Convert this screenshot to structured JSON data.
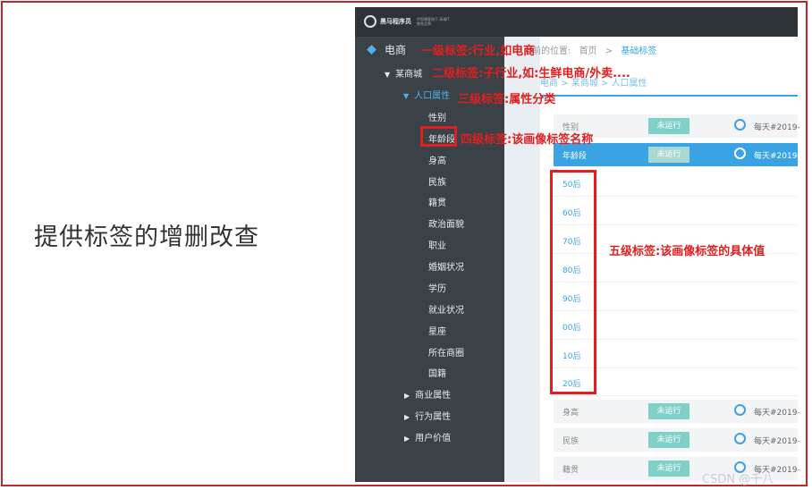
{
  "caption": "提供标签的增删改查",
  "header": {
    "logo_text": "黑马程序员",
    "logo_sub": "传智播客旗下 高端IT教育品牌"
  },
  "sidebar": {
    "level1": "电商",
    "level2": "某商城",
    "level3": "人口属性",
    "items": [
      "性别",
      "年龄段",
      "身高",
      "民族",
      "籍贯",
      "政治面貌",
      "职业",
      "婚姻状况",
      "学历",
      "就业状况",
      "星座",
      "所在商圈",
      "国籍"
    ],
    "collapsed": [
      "商业属性",
      "行为属性",
      "用户价值"
    ]
  },
  "breadcrumb": {
    "prefix": "当前的位置:",
    "home": "首页",
    "sep": ">",
    "current": "基础标签"
  },
  "path": "电商 > 某商城 > 人口属性",
  "rows_top": [
    {
      "name": "性别",
      "status": "未运行",
      "schedule": "每天#2019-"
    },
    {
      "name": "年龄段",
      "status": "未运行",
      "schedule": "每天#2019-"
    }
  ],
  "values": [
    "50后",
    "60后",
    "70后",
    "80后",
    "90后",
    "00后",
    "10后",
    "20后"
  ],
  "rows_bottom": [
    {
      "name": "身高",
      "status": "未运行",
      "schedule": "每天#2019-"
    },
    {
      "name": "民族",
      "status": "未运行",
      "schedule": "每天#2019-"
    },
    {
      "name": "籍贯",
      "status": "未运行",
      "schedule": "每天#2019-"
    }
  ],
  "annotations": {
    "level1": "一级标签:行业,如电商",
    "level2": "二级标签:子行业,如:生鲜电商/外卖....",
    "level3": "三级标签:属性分类",
    "level4": "四级标签:该画像标签名称",
    "level5": "五级标签:该画像标签的具体值"
  },
  "watermark": "CSDN @千八",
  "colors": {
    "accent": "#3aa3e3",
    "annotation": "#e02020",
    "sidebar": "#3b4247",
    "badge": "#7fd0c8"
  }
}
